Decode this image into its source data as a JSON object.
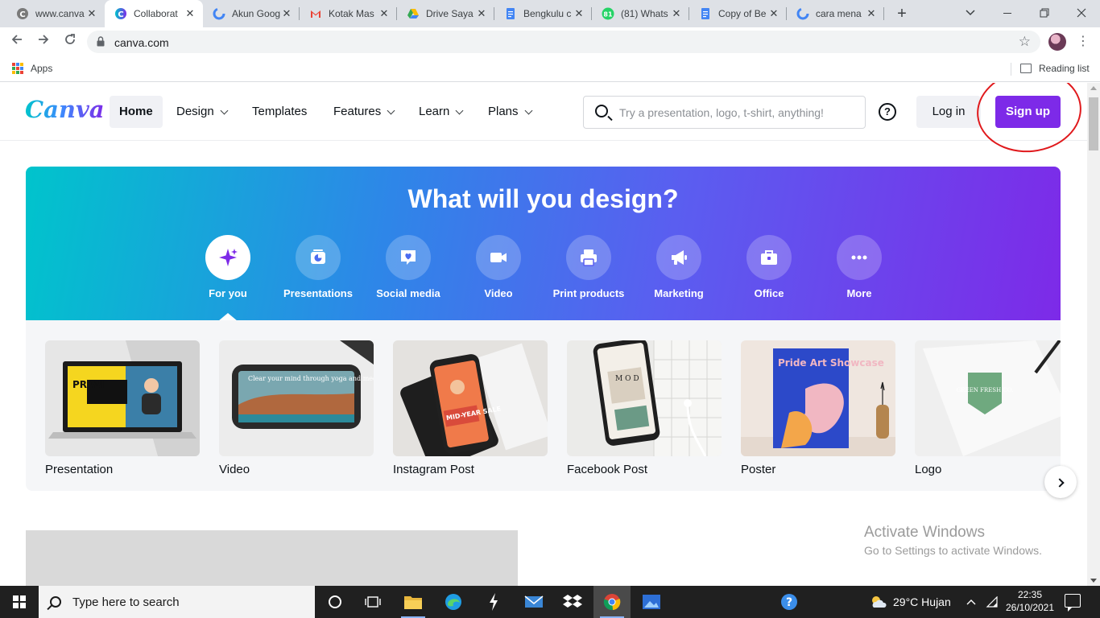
{
  "browser": {
    "tabs": [
      {
        "label": "www.canva",
        "favicon": "canva-gray-icon"
      },
      {
        "label": "Collaborat",
        "favicon": "canva-icon",
        "active": true
      },
      {
        "label": "Akun Goog",
        "favicon": "google-icon"
      },
      {
        "label": "Kotak Mas",
        "favicon": "gmail-icon"
      },
      {
        "label": "Drive Saya",
        "favicon": "drive-icon"
      },
      {
        "label": "Bengkulu c",
        "favicon": "docs-icon"
      },
      {
        "label": "(81) Whats",
        "favicon": "whatsapp-icon",
        "badge": "81"
      },
      {
        "label": "Copy of Be",
        "favicon": "docs-icon"
      },
      {
        "label": "cara mena",
        "favicon": "google-icon"
      }
    ],
    "close_glyph": "✕",
    "new_tab_glyph": "+",
    "url": "canva.com",
    "bookmarks": {
      "apps_label": "Apps",
      "reading_list_label": "Reading list"
    }
  },
  "canva": {
    "nav": {
      "logo": "Canva",
      "items": [
        {
          "label": "Home",
          "dropdown": false,
          "active": true
        },
        {
          "label": "Design",
          "dropdown": true
        },
        {
          "label": "Templates",
          "dropdown": false
        },
        {
          "label": "Features",
          "dropdown": true
        },
        {
          "label": "Learn",
          "dropdown": true
        },
        {
          "label": "Plans",
          "dropdown": true
        }
      ],
      "search_placeholder": "Try a presentation, logo, t-shirt, anything!",
      "help_glyph": "?",
      "login_label": "Log in",
      "signup_label": "Sign up"
    },
    "hero": {
      "title": "What will you design?",
      "categories": [
        {
          "label": "For you",
          "icon": "sparkle-icon",
          "active": true
        },
        {
          "label": "Presentations",
          "icon": "presentation-icon"
        },
        {
          "label": "Social media",
          "icon": "heart-chat-icon"
        },
        {
          "label": "Video",
          "icon": "video-camera-icon"
        },
        {
          "label": "Print products",
          "icon": "printer-icon"
        },
        {
          "label": "Marketing",
          "icon": "megaphone-icon"
        },
        {
          "label": "Office",
          "icon": "briefcase-icon"
        },
        {
          "label": "More",
          "icon": "more-dots-icon"
        }
      ]
    },
    "cards": [
      {
        "label": "Presentation",
        "thumb_text": "PR WI"
      },
      {
        "label": "Video",
        "thumb_text": "Clear your mind through yoga and meditation."
      },
      {
        "label": "Instagram Post",
        "thumb_text": "MID-YEAR SALE"
      },
      {
        "label": "Facebook Post",
        "thumb_text": "M O D"
      },
      {
        "label": "Poster",
        "thumb_text": "Pride Art Showcase"
      },
      {
        "label": "Logo",
        "thumb_text": "GREEN FRESH CO."
      }
    ],
    "watermark": {
      "title": "Activate Windows",
      "subtitle": "Go to Settings to activate Windows."
    }
  },
  "taskbar": {
    "search_placeholder": "Type here to search",
    "weather": "29°C  Hujan",
    "time": "22:35",
    "date": "26/10/2021"
  },
  "colors": {
    "accent": "#7d2ae8",
    "teal": "#00c4cc",
    "annotation": "#e0191c"
  }
}
